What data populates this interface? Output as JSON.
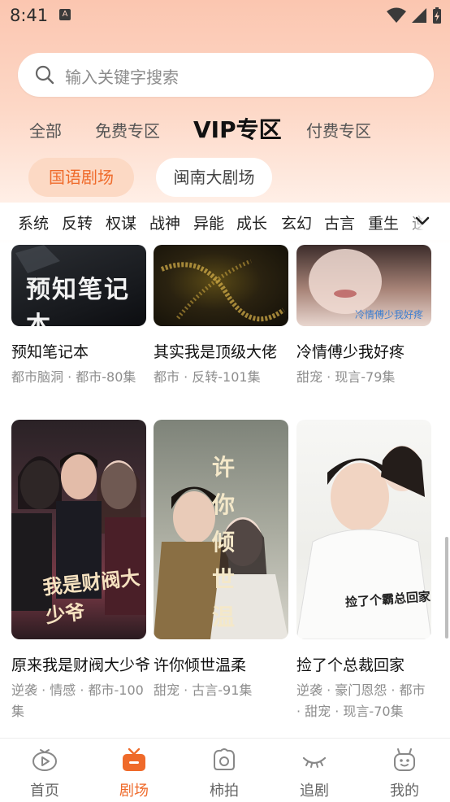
{
  "status_bar": {
    "time": "8:41"
  },
  "search": {
    "placeholder": "输入关键字搜索"
  },
  "zone_tabs": [
    "全部",
    "免费专区",
    "VIP专区",
    "付费专区"
  ],
  "zone_active": "VIP专区",
  "language_chips": [
    "国语剧场",
    "闽南大剧场"
  ],
  "genres": [
    "系统",
    "反转",
    "权谋",
    "战神",
    "异能",
    "成长",
    "玄幻",
    "古言",
    "重生",
    "逆"
  ],
  "dramas": [
    {
      "title": "预知笔记本",
      "tags": "都市脑洞 · 都市-80集",
      "poster_text": "预知笔记本"
    },
    {
      "title": "其实我是顶级大佬",
      "tags": "都市 · 反转-101集",
      "poster_text": ""
    },
    {
      "title": "冷情傅少我好疼",
      "tags": "甜宠 · 现言-79集",
      "poster_text": "冷情傅少我好疼"
    },
    {
      "title": "原来我是财阀大少爷",
      "tags": "逆袭 · 情感 · 都市-100集",
      "poster_text": "我是财阀大少爷"
    },
    {
      "title": "许你倾世温柔",
      "tags": "甜宠 · 古言-91集",
      "poster_text": "许你倾世温柔"
    },
    {
      "title": "捡了个总裁回家",
      "tags": "逆袭 · 豪门恩怨 · 都市 · 甜宠 · 现言-70集",
      "poster_text": "捡了个霸总回家"
    }
  ],
  "bottom_nav": [
    {
      "label": "首页",
      "icon": "tv-icon",
      "active": false
    },
    {
      "label": "剧场",
      "icon": "theater-icon",
      "active": true
    },
    {
      "label": "柿拍",
      "icon": "camera-icon",
      "active": false
    },
    {
      "label": "追剧",
      "icon": "eye-icon",
      "active": false
    },
    {
      "label": "我的",
      "icon": "robot-icon",
      "active": false
    }
  ],
  "colors": {
    "accent": "#ef6a2a",
    "header_gradient_top": "#fbc6b0",
    "chip_active_bg": "#fcd9c4"
  }
}
